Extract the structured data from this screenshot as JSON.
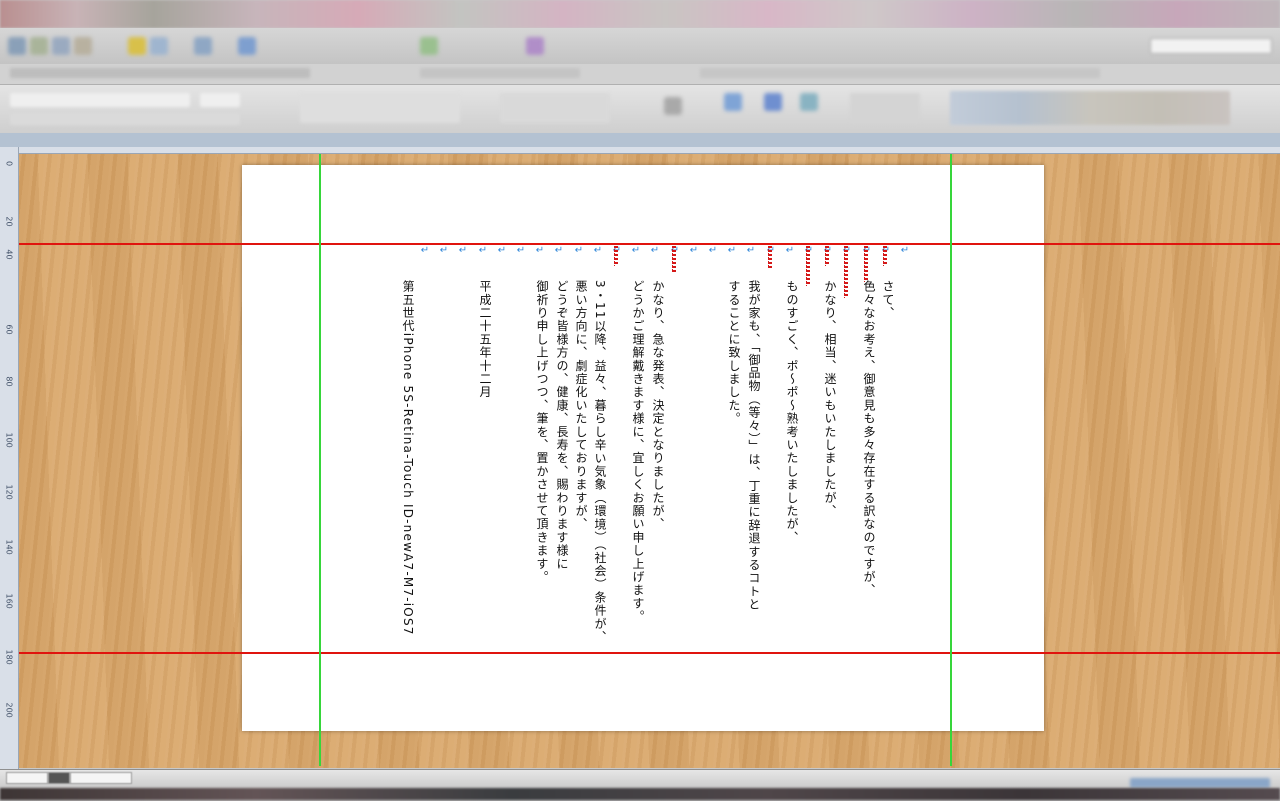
{
  "app": {
    "window_title": "",
    "accent_color": "#e0140e",
    "guide_color_vertical": "#36d63a"
  },
  "ruler": {
    "vertical_ticks": [
      "0",
      "20",
      "40",
      "60",
      "80",
      "100",
      "120",
      "140",
      "160",
      "180",
      "200"
    ]
  },
  "document": {
    "columns": [
      {
        "text": "さて、"
      },
      {
        "text": "色々なお考え、御意見も多々存在する訳なのですが、"
      },
      {
        "text": ""
      },
      {
        "text": "かなり、相当、迷いもいたしましたが、"
      },
      {
        "text": ""
      },
      {
        "text": "ものすごく、ポ～ポ～熟考いたしましたが、"
      },
      {
        "text": ""
      },
      {
        "text": "我が家も、「御品物（等々）」は、丁重に辞退するコトと"
      },
      {
        "text": "することに致しました。"
      },
      {
        "text": ""
      },
      {
        "text": ""
      },
      {
        "text": ""
      },
      {
        "text": "かなり、急な発表、決定となりましたが、"
      },
      {
        "text": "どうかご理解戴きます様に、宜しくお願い申し上げます。"
      },
      {
        "text": ""
      },
      {
        "text": "3・11以降、益々、暮らし辛い気象（環境）（社会）条件が、"
      },
      {
        "text": "悪い方向に、劇症化いたしておりますが、"
      },
      {
        "text": "どうぞ皆様方の、健康、長寿を、賜わります様に"
      },
      {
        "text": "御祈り申し上げつつ、筆を、置かさせて頂きます。"
      },
      {
        "text": ""
      },
      {
        "text": ""
      },
      {
        "text": "平成二十五年十二月"
      },
      {
        "text": ""
      },
      {
        "text": ""
      },
      {
        "text": ""
      },
      {
        "text": "第五世代iPhone 5S-Retina-Touch ID-newA7-M7-iOS7"
      }
    ]
  }
}
